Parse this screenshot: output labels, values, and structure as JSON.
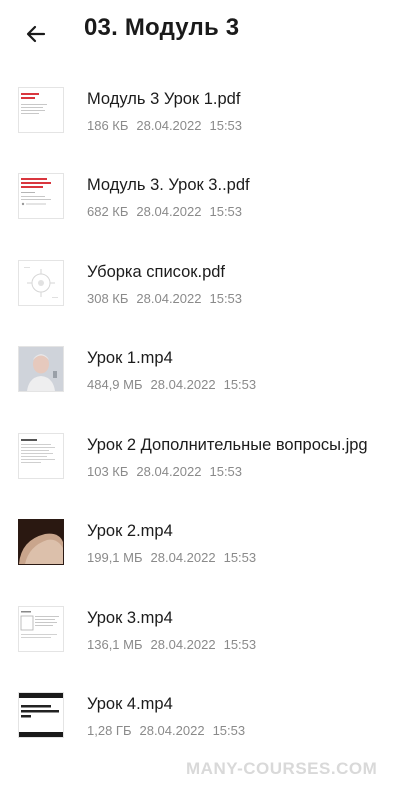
{
  "header": {
    "back_icon": "arrow-left-icon",
    "title": "03. Модуль 3"
  },
  "files": [
    {
      "name": "Модуль 3 Урок 1.pdf",
      "size": "186 КБ",
      "date": "28.04.2022",
      "time": "15:53",
      "thumb": "pdf-red-heading-thumbnail"
    },
    {
      "name": "Модуль 3. Урок 3..pdf",
      "size": "682 КБ",
      "date": "28.04.2022",
      "time": "15:53",
      "thumb": "pdf-red-heading-thumbnail"
    },
    {
      "name": "Уборка список.pdf",
      "size": "308 КБ",
      "date": "28.04.2022",
      "time": "15:53",
      "thumb": "pdf-grey-diagram-thumbnail"
    },
    {
      "name": "Урок 1.mp4",
      "size": "484,9 МБ",
      "date": "28.04.2022",
      "time": "15:53",
      "thumb": "video-person-thumbnail"
    },
    {
      "name": "Урок 2 Дополнительные вопросы.jpg",
      "size": "103 КБ",
      "date": "28.04.2022",
      "time": "15:53",
      "thumb": "image-text-document-thumbnail"
    },
    {
      "name": "Урок 2.mp4",
      "size": "199,1 МБ",
      "date": "28.04.2022",
      "time": "15:53",
      "thumb": "video-dark-photo-thumbnail"
    },
    {
      "name": "Урок 3.mp4",
      "size": "136,1 МБ",
      "date": "28.04.2022",
      "time": "15:53",
      "thumb": "video-document-thumbnail"
    },
    {
      "name": "Урок 4.mp4",
      "size": "1,28 ГБ",
      "date": "28.04.2022",
      "time": "15:53",
      "thumb": "video-black-text-thumbnail"
    }
  ],
  "watermark": {
    "text": "MANY-COURSES.COM"
  },
  "colors": {
    "text_primary": "#1c1c1c",
    "text_secondary": "#8a8a8a",
    "thumb_border": "#e4e4e4",
    "pdf_accent": "#d9363e"
  }
}
